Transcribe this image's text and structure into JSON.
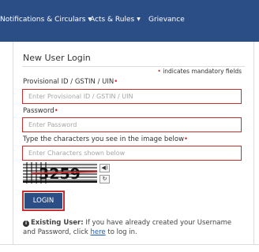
{
  "nav": {
    "items": [
      {
        "label": "Notifications & Circulars",
        "dropdown": true
      },
      {
        "label": "Acts & Rules",
        "dropdown": true
      },
      {
        "label": "Grievance",
        "dropdown": false
      }
    ]
  },
  "form": {
    "title": "New User Login",
    "mandatory_note": "indicates mandatory fields",
    "provisional": {
      "label": "Provisional ID / GSTIN / UIN",
      "placeholder": "Enter Provisional ID / GSTIN / UIN"
    },
    "password": {
      "label": "Password",
      "placeholder": "Enter Password"
    },
    "captcha": {
      "label": "Type the characters you see in the image below",
      "placeholder": "Enter Characters shown below",
      "image_text": "3259"
    },
    "login_label": "LOGIN",
    "existing": {
      "heading": "Existing User:",
      "text_before": "If you have already created your Username and Password, click",
      "link": "here",
      "text_after": "to log in."
    }
  },
  "colors": {
    "nav_bg": "#2c4e86",
    "required_star": "#cc2a2a",
    "field_border": "#c62f2f",
    "link": "#1a57b8"
  },
  "icons": [
    "speaker-icon",
    "refresh-icon",
    "info-circle-icon",
    "caret-down-icon"
  ]
}
